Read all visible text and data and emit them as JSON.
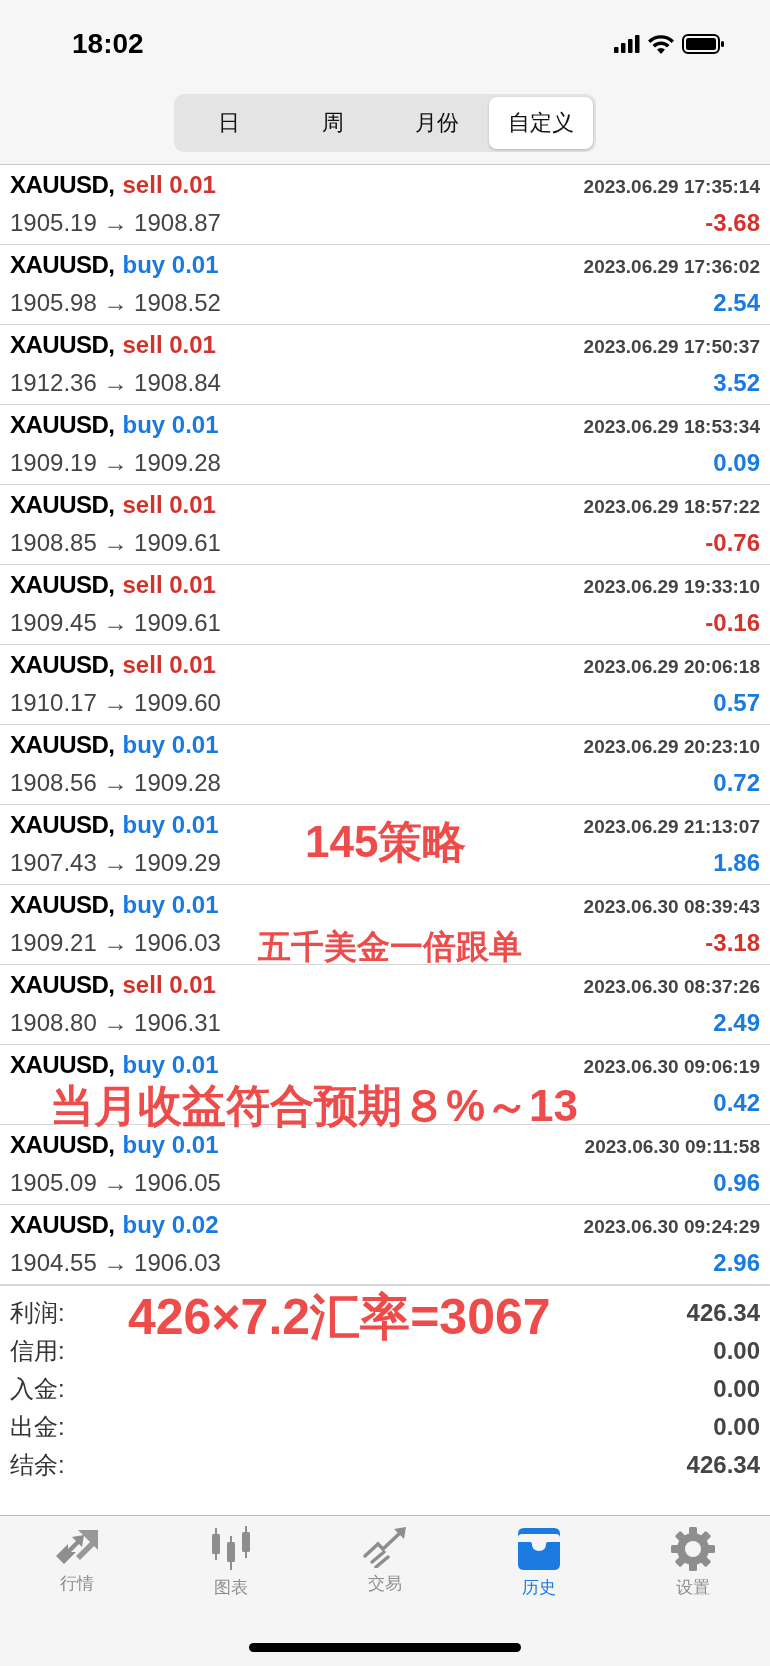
{
  "status_bar": {
    "time": "18:02"
  },
  "segments": [
    {
      "label": "日",
      "selected": false
    },
    {
      "label": "周",
      "selected": false
    },
    {
      "label": "月份",
      "selected": false
    },
    {
      "label": "自定义",
      "selected": true
    }
  ],
  "deals": [
    {
      "symbol": "XAUUSD,",
      "order": "sell 0.01",
      "sell": true,
      "time": "2023.06.29 17:35:14",
      "prices": "1905.19 → 1908.87",
      "profit": "-3.68",
      "loss": true
    },
    {
      "symbol": "XAUUSD,",
      "order": "buy 0.01",
      "sell": false,
      "time": "2023.06.29 17:36:02",
      "prices": "1905.98 → 1908.52",
      "profit": "2.54",
      "loss": false
    },
    {
      "symbol": "XAUUSD,",
      "order": "sell 0.01",
      "sell": true,
      "time": "2023.06.29 17:50:37",
      "prices": "1912.36 → 1908.84",
      "profit": "3.52",
      "loss": false
    },
    {
      "symbol": "XAUUSD,",
      "order": "buy 0.01",
      "sell": false,
      "time": "2023.06.29 18:53:34",
      "prices": "1909.19 → 1909.28",
      "profit": "0.09",
      "loss": false
    },
    {
      "symbol": "XAUUSD,",
      "order": "sell 0.01",
      "sell": true,
      "time": "2023.06.29 18:57:22",
      "prices": "1908.85 → 1909.61",
      "profit": "-0.76",
      "loss": true
    },
    {
      "symbol": "XAUUSD,",
      "order": "sell 0.01",
      "sell": true,
      "time": "2023.06.29 19:33:10",
      "prices": "1909.45 → 1909.61",
      "profit": "-0.16",
      "loss": true
    },
    {
      "symbol": "XAUUSD,",
      "order": "sell 0.01",
      "sell": true,
      "time": "2023.06.29 20:06:18",
      "prices": "1910.17 → 1909.60",
      "profit": "0.57",
      "loss": false
    },
    {
      "symbol": "XAUUSD,",
      "order": "buy 0.01",
      "sell": false,
      "time": "2023.06.29 20:23:10",
      "prices": "1908.56 → 1909.28",
      "profit": "0.72",
      "loss": false
    },
    {
      "symbol": "XAUUSD,",
      "order": "buy 0.01",
      "sell": false,
      "time": "2023.06.29 21:13:07",
      "prices": "1907.43 → 1909.29",
      "profit": "1.86",
      "loss": false,
      "annotation": {
        "text": "145策略",
        "kind": "title"
      }
    },
    {
      "symbol": "XAUUSD,",
      "order": "buy 0.01",
      "sell": false,
      "time": "2023.06.30 08:39:43",
      "prices": "1909.21 → 1906.03",
      "profit": "-3.18",
      "loss": true,
      "annotation": {
        "text": "五千美金一倍跟单",
        "kind": "note"
      }
    },
    {
      "symbol": "XAUUSD,",
      "order": "sell 0.01",
      "sell": true,
      "time": "2023.06.30 08:37:26",
      "prices": "1908.80 → 1906.31",
      "profit": "2.49",
      "loss": false
    },
    {
      "symbol": "XAUUSD,",
      "order": "buy 0.01",
      "sell": false,
      "time": "2023.06.30 09:06:19",
      "profit": "0.42",
      "loss": false,
      "annotation": {
        "text": "当月收益符合预期８%～13",
        "kind": "banner"
      }
    },
    {
      "symbol": "XAUUSD,",
      "order": "buy 0.01",
      "sell": false,
      "time": "2023.06.30 09:11:58",
      "prices": "1905.09 → 1906.05",
      "profit": "0.96",
      "loss": false
    },
    {
      "symbol": "XAUUSD,",
      "order": "buy 0.02",
      "sell": false,
      "time": "2023.06.30 09:24:29",
      "prices": "1904.55 → 1906.03",
      "profit": "2.96",
      "loss": false
    }
  ],
  "summary": [
    {
      "label": "利润:",
      "value": "426.34",
      "annotation": "426×7.2汇率=3067"
    },
    {
      "label": "信用:",
      "value": "0.00"
    },
    {
      "label": "入金:",
      "value": "0.00"
    },
    {
      "label": "出金:",
      "value": "0.00"
    },
    {
      "label": "结余:",
      "value": "426.34"
    }
  ],
  "tab_bar": [
    {
      "label": "行情",
      "selected": false
    },
    {
      "label": "图表",
      "selected": false
    },
    {
      "label": "交易",
      "selected": false
    },
    {
      "label": "历史",
      "selected": true
    },
    {
      "label": "设置",
      "selected": false
    }
  ]
}
